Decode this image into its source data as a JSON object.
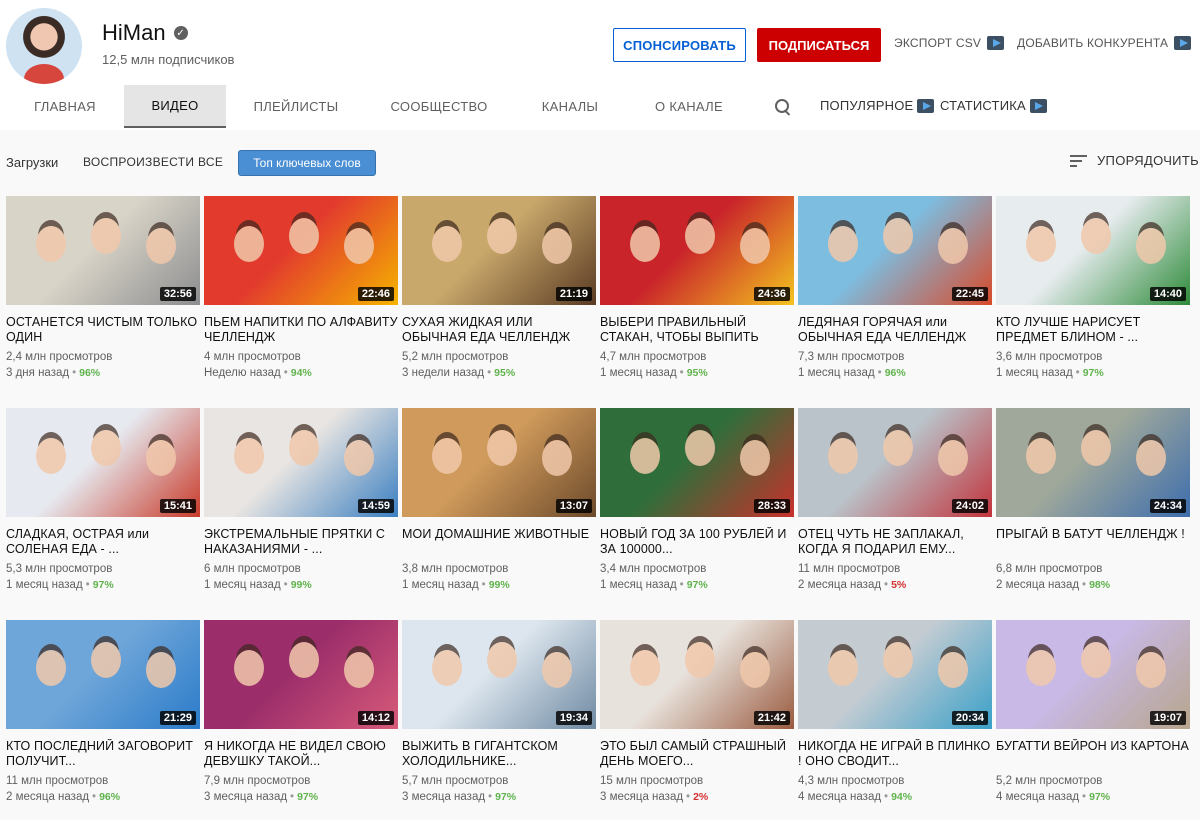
{
  "channel": {
    "name": "HiMan",
    "subscribers": "12,5 млн подписчиков",
    "sponsor_label": "СПОНСИРОВАТЬ",
    "subscribe_label": "ПОДПИСАТЬСЯ",
    "export_label": "ЭКСПОРТ CSV",
    "add_competitor_label": "ДОБАВИТЬ КОНКУРЕНТА"
  },
  "tabs": {
    "home": "ГЛАВНАЯ",
    "videos": "ВИДЕО",
    "playlists": "ПЛЕЙЛИСТЫ",
    "community": "СООБЩЕСТВО",
    "channels": "КАНАЛЫ",
    "about": "О КАНАЛЕ",
    "popular": "ПОПУЛЯРНОЕ",
    "stats": "СТАТИСТИКА"
  },
  "filters": {
    "uploads": "Загрузки",
    "play_all": "ВОСПРОИЗВЕСТИ ВСЕ",
    "keywords": "Топ ключевых слов",
    "sort": "УПОРЯДОЧИТЬ"
  },
  "videos": [
    {
      "title": "ОСТАНЕТСЯ ЧИСТЫМ ТОЛЬКО ОДИН",
      "duration": "32:56",
      "views": "2,4 млн просмотров",
      "age": "3 дня назад",
      "pct": "96%",
      "colors": [
        "#d9d4c8",
        "#8c8d8f"
      ]
    },
    {
      "title": "ПЬЕМ НАПИТКИ ПО АЛФАВИТУ ЧЕЛЛЕНДЖ",
      "duration": "22:46",
      "views": "4 млн просмотров",
      "age": "Неделю назад",
      "pct": "94%",
      "colors": [
        "#e23a2d",
        "#f5b400"
      ]
    },
    {
      "title": "СУХАЯ ЖИДКАЯ ИЛИ ОБЫЧНАЯ ЕДА ЧЕЛЛЕНДЖ",
      "duration": "21:19",
      "views": "5,2 млн просмотров",
      "age": "3 недели назад",
      "pct": "95%",
      "colors": [
        "#c9a86b",
        "#5a3b23"
      ]
    },
    {
      "title": "ВЫБЕРИ ПРАВИЛЬНЫЙ СТАКАН, ЧТОБЫ ВЫПИТЬ",
      "duration": "24:36",
      "views": "4,7 млн просмотров",
      "age": "1 месяц назад",
      "pct": "95%",
      "colors": [
        "#c9242a",
        "#f3c41f"
      ]
    },
    {
      "title": "ЛЕДЯНАЯ ГОРЯЧАЯ или ОБЫЧНАЯ ЕДА ЧЕЛЛЕНДЖ",
      "duration": "22:45",
      "views": "7,3 млн просмотров",
      "age": "1 месяц назад",
      "pct": "96%",
      "colors": [
        "#7dbde0",
        "#d94a2a"
      ]
    },
    {
      "title": "КТО ЛУЧШЕ НАРИСУЕТ ПРЕДМЕТ БЛИНОМ - ...",
      "duration": "14:40",
      "views": "3,6 млн просмотров",
      "age": "1 месяц назад",
      "pct": "97%",
      "colors": [
        "#e7ecef",
        "#2e8b3a"
      ]
    },
    {
      "title": "СЛАДКАЯ, ОСТРАЯ или СОЛЕНАЯ ЕДА - ...",
      "duration": "15:41",
      "views": "5,3 млн просмотров",
      "age": "1 месяц назад",
      "pct": "97%",
      "colors": [
        "#e6eaf0",
        "#c83a2a"
      ]
    },
    {
      "title": "ЭКСТРЕМАЛЬНЫЕ ПРЯТКИ С НАКАЗАНИЯМИ - ...",
      "duration": "14:59",
      "views": "6 млн просмотров",
      "age": "1 месяц назад",
      "pct": "99%",
      "colors": [
        "#e9e5e2",
        "#3a7fc1"
      ]
    },
    {
      "title": "МОИ ДОМАШНИЕ ЖИВОТНЫЕ",
      "duration": "13:07",
      "views": "3,8 млн просмотров",
      "age": "1 месяц назад",
      "pct": "99%",
      "colors": [
        "#cf9a5b",
        "#6d4a2b"
      ]
    },
    {
      "title": "НОВЫЙ ГОД ЗА 100 РУБЛЕЙ И ЗА 100000...",
      "duration": "28:33",
      "views": "3,4 млн просмотров",
      "age": "1 месяц назад",
      "pct": "97%",
      "colors": [
        "#2f6e3a",
        "#c8312c"
      ]
    },
    {
      "title": "ОТЕЦ ЧУТЬ НЕ ЗАПЛАКАЛ, КОГДА Я ПОДАРИЛ ЕМУ...",
      "duration": "24:02",
      "views": "11 млн просмотров",
      "age": "2 месяца назад",
      "pct": "5%",
      "colors": [
        "#b9c3c9",
        "#c2333c"
      ]
    },
    {
      "title": "ПРЫГАЙ В БАТУТ ЧЕЛЛЕНДЖ !",
      "duration": "24:34",
      "views": "6,8 млн просмотров",
      "age": "2 месяца назад",
      "pct": "98%",
      "colors": [
        "#9fa89b",
        "#3d6dad"
      ]
    },
    {
      "title": "КТО ПОСЛЕДНИЙ ЗАГОВОРИТ ПОЛУЧИТ...",
      "duration": "21:29",
      "views": "11 млн просмотров",
      "age": "2 месяца назад",
      "pct": "96%",
      "colors": [
        "#6fa6d9",
        "#2b7bc9"
      ]
    },
    {
      "title": "Я НИКОГДА НЕ ВИДЕЛ СВОЮ ДЕВУШКУ ТАКОЙ...",
      "duration": "14:12",
      "views": "7,9 млн просмотров",
      "age": "3 месяца назад",
      "pct": "97%",
      "colors": [
        "#9a2d6a",
        "#d85a7a"
      ]
    },
    {
      "title": "ВЫЖИТЬ В ГИГАНТСКОМ ХОЛОДИЛЬНИКЕ...",
      "duration": "19:34",
      "views": "5,7 млн просмотров",
      "age": "3 месяца назад",
      "pct": "97%",
      "colors": [
        "#dde6ee",
        "#6f8aa3"
      ]
    },
    {
      "title": "ЭТО БЫЛ САМЫЙ СТРАШНЫЙ ДЕНЬ МОЕГО...",
      "duration": "21:42",
      "views": "15 млн просмотров",
      "age": "3 месяца назад",
      "pct": "2%",
      "colors": [
        "#e8e2dc",
        "#9a5b3f"
      ]
    },
    {
      "title": "НИКОГДА НЕ ИГРАЙ В ПЛИНКО ! ОНО СВОДИТ...",
      "duration": "20:34",
      "views": "4,3 млн просмотров",
      "age": "4 месяца назад",
      "pct": "94%",
      "colors": [
        "#c4ccd2",
        "#3aa0c9"
      ]
    },
    {
      "title": "БУГАТТИ ВЕЙРОН ИЗ КАРТОНА",
      "duration": "19:07",
      "views": "5,2 млн просмотров",
      "age": "4 месяца назад",
      "pct": "97%",
      "colors": [
        "#c8b9e6",
        "#b7a58c"
      ]
    }
  ]
}
